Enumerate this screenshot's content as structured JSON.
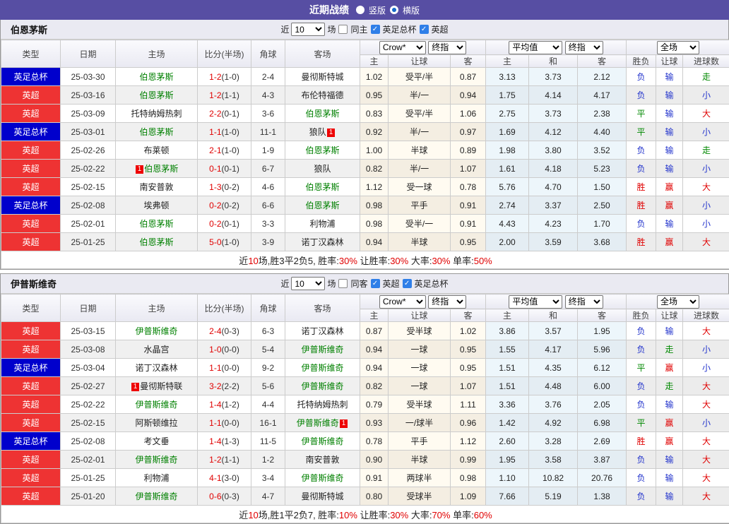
{
  "topbar": {
    "title": "近期战绩",
    "vertical_label": "竖版",
    "horizontal_label": "横版",
    "selected": "横版"
  },
  "colors": {
    "topbar_bg": "#574EA3",
    "type": {
      "英超": "#EE3333",
      "英足总杯": "#0000CC"
    },
    "result": {
      "胜": "#E00000",
      "赢": "#E00000",
      "大": "#E00000",
      "平": "#008800",
      "走": "#008800",
      "负": "#2233CC",
      "输": "#2233CC",
      "小": "#2233CC"
    },
    "score": "#E00000",
    "focal_team": "#008000",
    "card_bg": "#EE0000"
  },
  "columns": {
    "left": [
      "类型",
      "日期",
      "主场",
      "比分(半场)",
      "角球",
      "客场"
    ],
    "sub": [
      "主",
      "让球",
      "客",
      "主",
      "和",
      "客",
      "胜负",
      "让球",
      "进球数"
    ],
    "dropdowns": {
      "crow": "Crow*",
      "final1": "终指",
      "average": "平均值",
      "final2": "终指",
      "fulltime": "全场"
    }
  },
  "tables": [
    {
      "team": "伯恩茅斯",
      "filter": {
        "near": "近",
        "count": "10",
        "games": "场",
        "boxes": [
          {
            "label": "同主",
            "checked": false
          },
          {
            "label": "英足总杯",
            "checked": true
          },
          {
            "label": "英超",
            "checked": true
          }
        ]
      },
      "rows": [
        {
          "type": "英足总杯",
          "date": "25-03-30",
          "home": {
            "name": "伯恩茅斯",
            "focal": true
          },
          "score": "1-2",
          "half": "(1-0)",
          "corner": "2-4",
          "away": {
            "name": "曼彻斯特城"
          },
          "odds": [
            "1.02",
            "受平/半",
            "0.87"
          ],
          "avg": [
            "3.13",
            "3.73",
            "2.12"
          ],
          "res": [
            "负",
            "输",
            "走"
          ]
        },
        {
          "type": "英超",
          "date": "25-03-16",
          "home": {
            "name": "伯恩茅斯",
            "focal": true
          },
          "score": "1-2",
          "half": "(1-1)",
          "corner": "4-3",
          "away": {
            "name": "布伦特福德"
          },
          "odds": [
            "0.95",
            "半/一",
            "0.94"
          ],
          "avg": [
            "1.75",
            "4.14",
            "4.17"
          ],
          "res": [
            "负",
            "输",
            "小"
          ]
        },
        {
          "type": "英超",
          "date": "25-03-09",
          "home": {
            "name": "托特纳姆热刺"
          },
          "score": "2-2",
          "half": "(0-1)",
          "corner": "3-6",
          "away": {
            "name": "伯恩茅斯",
            "focal": true
          },
          "odds": [
            "0.83",
            "受平/半",
            "1.06"
          ],
          "avg": [
            "2.75",
            "3.73",
            "2.38"
          ],
          "res": [
            "平",
            "输",
            "大"
          ]
        },
        {
          "type": "英足总杯",
          "date": "25-03-01",
          "home": {
            "name": "伯恩茅斯",
            "focal": true
          },
          "score": "1-1",
          "half": "(1-0)",
          "corner": "11-1",
          "away": {
            "name": "狼队",
            "card": "after"
          },
          "odds": [
            "0.92",
            "半/一",
            "0.97"
          ],
          "avg": [
            "1.69",
            "4.12",
            "4.40"
          ],
          "res": [
            "平",
            "输",
            "小"
          ]
        },
        {
          "type": "英超",
          "date": "25-02-26",
          "home": {
            "name": "布莱顿"
          },
          "score": "2-1",
          "half": "(1-0)",
          "corner": "1-9",
          "away": {
            "name": "伯恩茅斯",
            "focal": true
          },
          "odds": [
            "1.00",
            "半球",
            "0.89"
          ],
          "avg": [
            "1.98",
            "3.80",
            "3.52"
          ],
          "res": [
            "负",
            "输",
            "走"
          ]
        },
        {
          "type": "英超",
          "date": "25-02-22",
          "home": {
            "name": "伯恩茅斯",
            "focal": true,
            "card": "before"
          },
          "score": "0-1",
          "half": "(0-1)",
          "corner": "6-7",
          "away": {
            "name": "狼队"
          },
          "odds": [
            "0.82",
            "半/一",
            "1.07"
          ],
          "avg": [
            "1.61",
            "4.18",
            "5.23"
          ],
          "res": [
            "负",
            "输",
            "小"
          ]
        },
        {
          "type": "英超",
          "date": "25-02-15",
          "home": {
            "name": "南安普敦"
          },
          "score": "1-3",
          "half": "(0-2)",
          "corner": "4-6",
          "away": {
            "name": "伯恩茅斯",
            "focal": true
          },
          "odds": [
            "1.12",
            "受一球",
            "0.78"
          ],
          "avg": [
            "5.76",
            "4.70",
            "1.50"
          ],
          "res": [
            "胜",
            "赢",
            "大"
          ]
        },
        {
          "type": "英足总杯",
          "date": "25-02-08",
          "home": {
            "name": "埃弗顿"
          },
          "score": "0-2",
          "half": "(0-2)",
          "corner": "6-6",
          "away": {
            "name": "伯恩茅斯",
            "focal": true
          },
          "odds": [
            "0.98",
            "平手",
            "0.91"
          ],
          "avg": [
            "2.74",
            "3.37",
            "2.50"
          ],
          "res": [
            "胜",
            "赢",
            "小"
          ]
        },
        {
          "type": "英超",
          "date": "25-02-01",
          "home": {
            "name": "伯恩茅斯",
            "focal": true
          },
          "score": "0-2",
          "half": "(0-1)",
          "corner": "3-3",
          "away": {
            "name": "利物浦"
          },
          "odds": [
            "0.98",
            "受半/一",
            "0.91"
          ],
          "avg": [
            "4.43",
            "4.23",
            "1.70"
          ],
          "res": [
            "负",
            "输",
            "小"
          ]
        },
        {
          "type": "英超",
          "date": "25-01-25",
          "home": {
            "name": "伯恩茅斯",
            "focal": true
          },
          "score": "5-0",
          "half": "(1-0)",
          "corner": "3-9",
          "away": {
            "name": "诺丁汉森林"
          },
          "odds": [
            "0.94",
            "半球",
            "0.95"
          ],
          "avg": [
            "2.00",
            "3.59",
            "3.68"
          ],
          "res": [
            "胜",
            "赢",
            "大"
          ]
        }
      ],
      "summary": [
        {
          "t": "近",
          "r": false
        },
        {
          "t": "10",
          "r": true
        },
        {
          "t": "场,胜3平2负5, 胜率:",
          "r": false
        },
        {
          "t": "30%",
          "r": true
        },
        {
          "t": " 让胜率:",
          "r": false
        },
        {
          "t": "30%",
          "r": true
        },
        {
          "t": " 大率:",
          "r": false
        },
        {
          "t": "30%",
          "r": true
        },
        {
          "t": " 单率:",
          "r": false
        },
        {
          "t": "50%",
          "r": true
        }
      ]
    },
    {
      "team": "伊普斯维奇",
      "filter": {
        "near": "近",
        "count": "10",
        "games": "场",
        "boxes": [
          {
            "label": "同客",
            "checked": false
          },
          {
            "label": "英超",
            "checked": true
          },
          {
            "label": "英足总杯",
            "checked": true
          }
        ]
      },
      "rows": [
        {
          "type": "英超",
          "date": "25-03-15",
          "home": {
            "name": "伊普斯维奇",
            "focal": true
          },
          "score": "2-4",
          "half": "(0-3)",
          "corner": "6-3",
          "away": {
            "name": "诺丁汉森林"
          },
          "odds": [
            "0.87",
            "受半球",
            "1.02"
          ],
          "avg": [
            "3.86",
            "3.57",
            "1.95"
          ],
          "res": [
            "负",
            "输",
            "大"
          ]
        },
        {
          "type": "英超",
          "date": "25-03-08",
          "home": {
            "name": "水晶宫"
          },
          "score": "1-0",
          "half": "(0-0)",
          "corner": "5-4",
          "away": {
            "name": "伊普斯维奇",
            "focal": true
          },
          "odds": [
            "0.94",
            "一球",
            "0.95"
          ],
          "avg": [
            "1.55",
            "4.17",
            "5.96"
          ],
          "res": [
            "负",
            "走",
            "小"
          ]
        },
        {
          "type": "英足总杯",
          "date": "25-03-04",
          "home": {
            "name": "诺丁汉森林"
          },
          "score": "1-1",
          "half": "(0-0)",
          "corner": "9-2",
          "away": {
            "name": "伊普斯维奇",
            "focal": true
          },
          "odds": [
            "0.94",
            "一球",
            "0.95"
          ],
          "avg": [
            "1.51",
            "4.35",
            "6.12"
          ],
          "res": [
            "平",
            "赢",
            "小"
          ]
        },
        {
          "type": "英超",
          "date": "25-02-27",
          "home": {
            "name": "曼彻斯特联",
            "card": "before"
          },
          "score": "3-2",
          "half": "(2-2)",
          "corner": "5-6",
          "away": {
            "name": "伊普斯维奇",
            "focal": true
          },
          "odds": [
            "0.82",
            "一球",
            "1.07"
          ],
          "avg": [
            "1.51",
            "4.48",
            "6.00"
          ],
          "res": [
            "负",
            "走",
            "大"
          ]
        },
        {
          "type": "英超",
          "date": "25-02-22",
          "home": {
            "name": "伊普斯维奇",
            "focal": true
          },
          "score": "1-4",
          "half": "(1-2)",
          "corner": "4-4",
          "away": {
            "name": "托特纳姆热刺"
          },
          "odds": [
            "0.79",
            "受半球",
            "1.11"
          ],
          "avg": [
            "3.36",
            "3.76",
            "2.05"
          ],
          "res": [
            "负",
            "输",
            "大"
          ]
        },
        {
          "type": "英超",
          "date": "25-02-15",
          "home": {
            "name": "阿斯顿维拉"
          },
          "score": "1-1",
          "half": "(0-0)",
          "corner": "16-1",
          "away": {
            "name": "伊普斯维奇",
            "focal": true,
            "card": "after"
          },
          "odds": [
            "0.93",
            "一/球半",
            "0.96"
          ],
          "avg": [
            "1.42",
            "4.92",
            "6.98"
          ],
          "res": [
            "平",
            "赢",
            "小"
          ]
        },
        {
          "type": "英足总杯",
          "date": "25-02-08",
          "home": {
            "name": "考文垂"
          },
          "score": "1-4",
          "half": "(1-3)",
          "corner": "11-5",
          "away": {
            "name": "伊普斯维奇",
            "focal": true
          },
          "odds": [
            "0.78",
            "平手",
            "1.12"
          ],
          "avg": [
            "2.60",
            "3.28",
            "2.69"
          ],
          "res": [
            "胜",
            "赢",
            "大"
          ]
        },
        {
          "type": "英超",
          "date": "25-02-01",
          "home": {
            "name": "伊普斯维奇",
            "focal": true
          },
          "score": "1-2",
          "half": "(1-1)",
          "corner": "1-2",
          "away": {
            "name": "南安普敦"
          },
          "odds": [
            "0.90",
            "半球",
            "0.99"
          ],
          "avg": [
            "1.95",
            "3.58",
            "3.87"
          ],
          "res": [
            "负",
            "输",
            "大"
          ]
        },
        {
          "type": "英超",
          "date": "25-01-25",
          "home": {
            "name": "利物浦"
          },
          "score": "4-1",
          "half": "(3-0)",
          "corner": "3-4",
          "away": {
            "name": "伊普斯维奇",
            "focal": true
          },
          "odds": [
            "0.91",
            "两球半",
            "0.98"
          ],
          "avg": [
            "1.10",
            "10.82",
            "20.76"
          ],
          "res": [
            "负",
            "输",
            "大"
          ]
        },
        {
          "type": "英超",
          "date": "25-01-20",
          "home": {
            "name": "伊普斯维奇",
            "focal": true
          },
          "score": "0-6",
          "half": "(0-3)",
          "corner": "4-7",
          "away": {
            "name": "曼彻斯特城"
          },
          "odds": [
            "0.80",
            "受球半",
            "1.09"
          ],
          "avg": [
            "7.66",
            "5.19",
            "1.38"
          ],
          "res": [
            "负",
            "输",
            "大"
          ]
        }
      ],
      "summary": [
        {
          "t": "近",
          "r": false
        },
        {
          "t": "10",
          "r": true
        },
        {
          "t": "场,胜1平2负7, 胜率:",
          "r": false
        },
        {
          "t": "10%",
          "r": true
        },
        {
          "t": " 让胜率:",
          "r": false
        },
        {
          "t": "30%",
          "r": true
        },
        {
          "t": " 大率:",
          "r": false
        },
        {
          "t": "70%",
          "r": true
        },
        {
          "t": " 单率:",
          "r": false
        },
        {
          "t": "60%",
          "r": true
        }
      ]
    }
  ]
}
